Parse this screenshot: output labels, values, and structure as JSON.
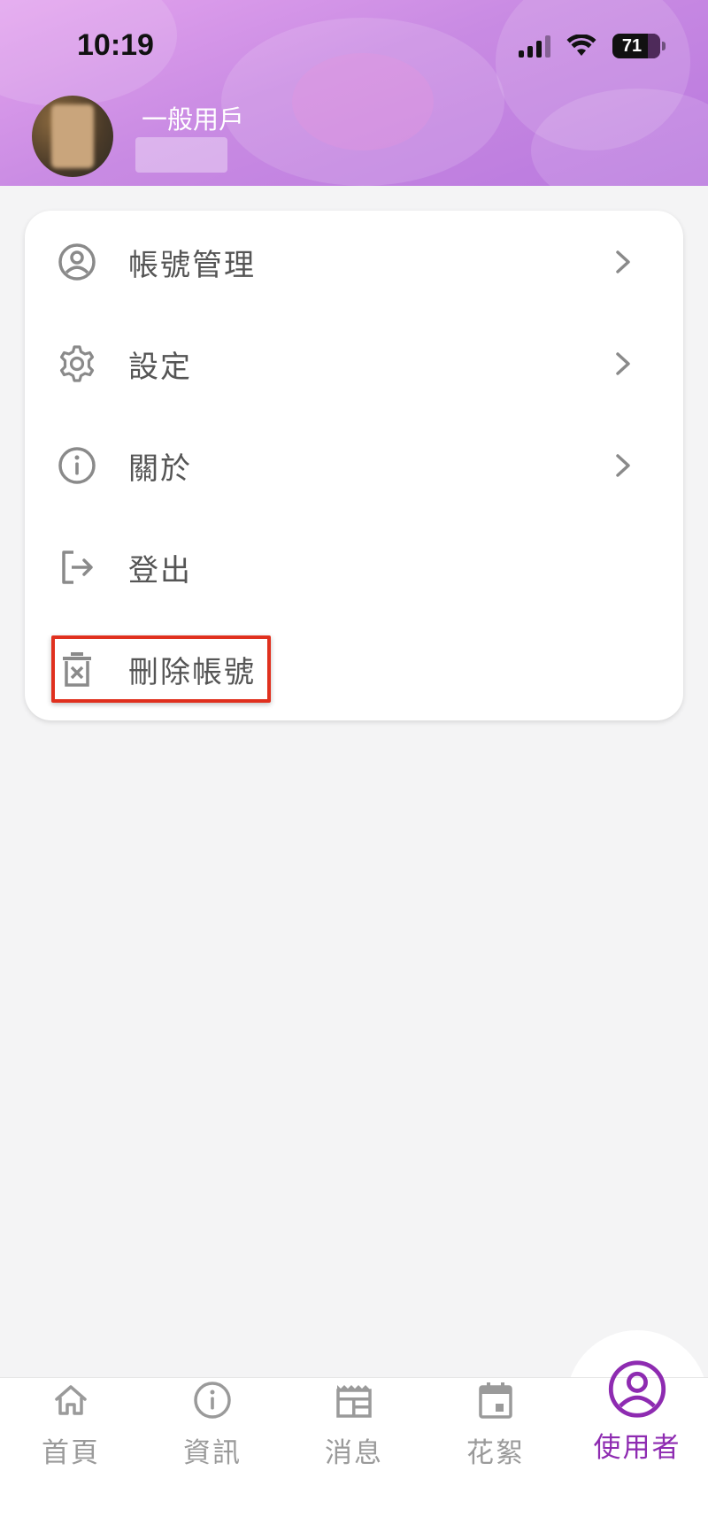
{
  "status_bar": {
    "time": "10:19",
    "battery": "71"
  },
  "profile": {
    "username": "一般用戶"
  },
  "menu": {
    "items": [
      {
        "label": "帳號管理",
        "icon": "user-circle-icon",
        "has_chevron": true
      },
      {
        "label": "設定",
        "icon": "gear-icon",
        "has_chevron": true
      },
      {
        "label": "關於",
        "icon": "info-icon",
        "has_chevron": true
      },
      {
        "label": "登出",
        "icon": "logout-icon",
        "has_chevron": false
      },
      {
        "label": "刪除帳號",
        "icon": "trash-icon",
        "has_chevron": false,
        "highlighted": true
      }
    ]
  },
  "bottom_nav": {
    "items": [
      {
        "label": "首頁",
        "icon": "home-icon"
      },
      {
        "label": "資訊",
        "icon": "info-icon"
      },
      {
        "label": "消息",
        "icon": "newspaper-icon"
      },
      {
        "label": "花絮",
        "icon": "calendar-icon"
      },
      {
        "label": "使用者",
        "icon": "user-circle-icon",
        "active": true
      }
    ]
  },
  "colors": {
    "accent": "#8e2bb1",
    "highlight_border": "#e0301e",
    "header_gradient_start": "#e3a3ee",
    "header_gradient_end": "#b978de",
    "icon_gray": "#9a9a9a"
  }
}
